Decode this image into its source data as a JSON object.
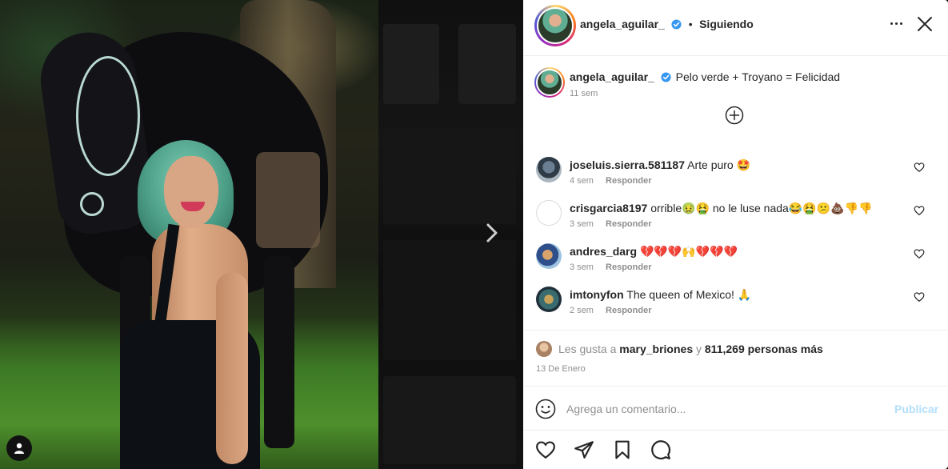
{
  "post": {
    "username": "angela_aguilar_",
    "dot": "•",
    "follow_status": "Siguiendo",
    "caption": "Pelo verde + Troyano = Felicidad",
    "caption_time": "11 sem"
  },
  "comments": [
    {
      "user": "joseluis.sierra.581187",
      "text": "Arte puro 🤩",
      "time": "4 sem",
      "reply": "Responder"
    },
    {
      "user": "crisgarcia8197",
      "text": "orrible🤢🤮  no le luse nada😂🤮😕💩👎👎",
      "time": "3 sem",
      "reply": "Responder"
    },
    {
      "user": "andres_darg",
      "text": "💔💔💔🙌💔💔💔",
      "time": "3 sem",
      "reply": "Responder"
    },
    {
      "user": "imtonyfon",
      "text": "The queen of Mexico! 🙏",
      "time": "2 sem",
      "reply": "Responder"
    }
  ],
  "likes": {
    "prefix": "Les gusta a",
    "user": "mary_briones",
    "connector": "y",
    "count_text": "811,269 personas más"
  },
  "date": "13 De Enero",
  "comment_box": {
    "placeholder": "Agrega un comentario...",
    "publish_label": "Publicar"
  },
  "icons": {
    "verified": "verified-badge-icon",
    "more": "more-options-icon",
    "close": "close-icon",
    "load_more": "plus-circle-icon",
    "heart": "heart-icon",
    "emoji": "emoji-icon",
    "like": "heart-icon",
    "share": "paper-plane-icon",
    "save": "bookmark-icon",
    "comment": "comment-bubble-icon",
    "next": "chevron-right-icon",
    "user_tag": "user-tag-icon"
  },
  "colors": {
    "verified_blue": "#3897f0",
    "publish_disabled": "#b2dffc",
    "text_primary": "#262626",
    "text_muted": "#8e8e8e"
  }
}
